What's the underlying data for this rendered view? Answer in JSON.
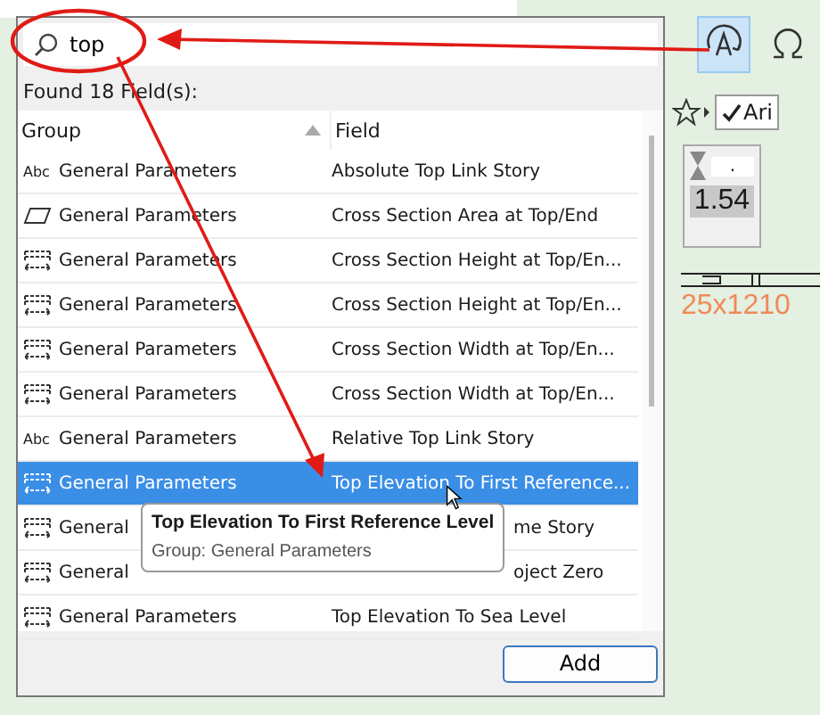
{
  "search": {
    "value": "top"
  },
  "result_count": "Found 18 Field(s):",
  "table": {
    "columns": [
      {
        "label": "Group",
        "sorted": true
      },
      {
        "label": "Field",
        "sorted": false
      }
    ],
    "rows": [
      {
        "kind": "text",
        "icon_text": "Abc",
        "group": "General Parameters",
        "field": "Absolute Top Link Story",
        "selected": false,
        "covered": false
      },
      {
        "kind": "area",
        "group": "General Parameters",
        "field": "Cross Section Area at Top/End",
        "selected": false,
        "covered": false
      },
      {
        "kind": "dimension",
        "group": "General Parameters",
        "field": "Cross Section Height at Top/En...",
        "selected": false,
        "covered": false
      },
      {
        "kind": "dimension",
        "group": "General Parameters",
        "field": "Cross Section Height at Top/En...",
        "selected": false,
        "covered": false
      },
      {
        "kind": "dimension",
        "group": "General Parameters",
        "field": "Cross Section Width at Top/En...",
        "selected": false,
        "covered": false
      },
      {
        "kind": "dimension",
        "group": "General Parameters",
        "field": "Cross Section Width at Top/En...",
        "selected": false,
        "covered": false
      },
      {
        "kind": "text",
        "icon_text": "Abc",
        "group": "General Parameters",
        "field": "Relative Top Link Story",
        "selected": false,
        "covered": false
      },
      {
        "kind": "dimension",
        "group": "General Parameters",
        "field": "Top Elevation To First Reference...",
        "selected": true,
        "covered": false
      },
      {
        "kind": "dimension",
        "group": "General",
        "field": "me Story",
        "selected": false,
        "covered": true
      },
      {
        "kind": "dimension",
        "group": "General",
        "field": "oject Zero",
        "selected": false,
        "covered": true
      },
      {
        "kind": "dimension",
        "group": "General Parameters",
        "field": "Top Elevation To Sea Level",
        "selected": false,
        "covered": false
      }
    ]
  },
  "tooltip": {
    "title": "Top Elevation To First Reference Level",
    "subtitle": "Group: General Parameters"
  },
  "add_button": "Add",
  "toolbar": {
    "tools": [
      {
        "kind": "text-rotate",
        "selected": true
      },
      {
        "kind": "omega",
        "selected": false
      }
    ],
    "font_dropdown": {
      "label": "Ari",
      "checked": true
    }
  },
  "info_panel": {
    "value": ".",
    "reading": "1.54"
  },
  "dimension_label": "25x1210"
}
